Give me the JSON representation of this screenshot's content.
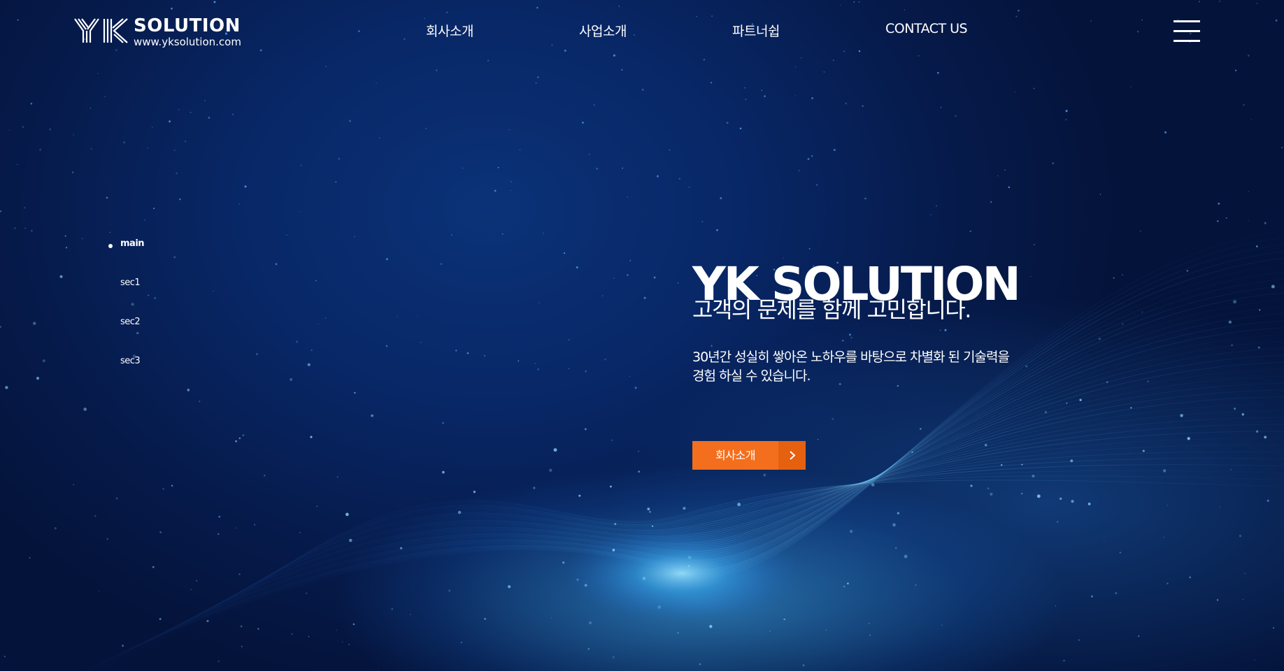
{
  "brand": {
    "name": "SOLUTION",
    "url": "www.yksolution.com",
    "logo_mark_text": "YK"
  },
  "nav": {
    "items": [
      {
        "label": "회사소개"
      },
      {
        "label": "사업소개"
      },
      {
        "label": "파트너쉽"
      },
      {
        "label": "CONTACT US"
      }
    ],
    "menu_icon": "hamburger-menu-icon"
  },
  "sidenav": {
    "items": [
      {
        "label": "main",
        "active": true
      },
      {
        "label": "sec1",
        "active": false
      },
      {
        "label": "sec2",
        "active": false
      },
      {
        "label": "sec3",
        "active": false
      }
    ]
  },
  "hero": {
    "title": "YK SOLUTION",
    "subtitle": "고객의 문제를 함께 고민합니다.",
    "description_line1": "30년간 성실히 쌓아온 노하우를 바탕으로 차별화 된 기술력을",
    "description_line2": "경험 하실 수 있습니다.",
    "cta_label": "회사소개",
    "cta_icon": "chevron-right-icon"
  },
  "colors": {
    "background": "#061a4a",
    "accent": "#f36f1d",
    "accent_dark": "#e5600f",
    "text": "#ffffff"
  }
}
